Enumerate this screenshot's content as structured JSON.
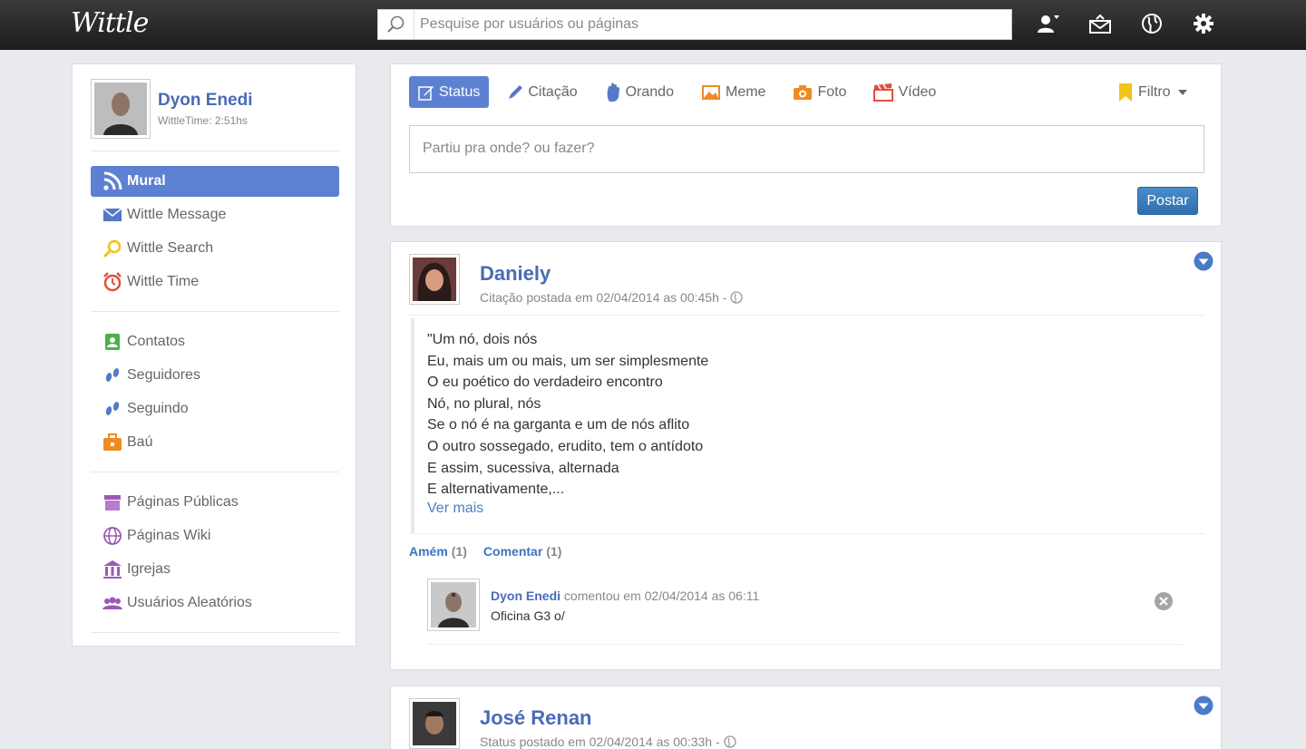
{
  "app": {
    "logo": "Wittle"
  },
  "search": {
    "placeholder": "Pesquise por usuários ou páginas",
    "value": ""
  },
  "top_icons": [
    "friend-request-icon",
    "messages-icon",
    "globe-icon",
    "gear-icon"
  ],
  "profile": {
    "name": "Dyon Enedi",
    "wittletime": "WittleTime: 2:51hs"
  },
  "sidebar": {
    "group1": [
      {
        "label": "Mural",
        "icon": "rss-icon",
        "active": true
      },
      {
        "label": "Wittle Message",
        "icon": "envelope-icon"
      },
      {
        "label": "Wittle Search",
        "icon": "magnifier-icon"
      },
      {
        "label": "Wittle Time",
        "icon": "alarm-clock-icon"
      }
    ],
    "group2": [
      {
        "label": "Contatos",
        "icon": "contacts-icon"
      },
      {
        "label": "Seguidores",
        "icon": "footprints-icon"
      },
      {
        "label": "Seguindo",
        "icon": "footprints-icon"
      },
      {
        "label": "Baú",
        "icon": "chest-icon"
      }
    ],
    "group3": [
      {
        "label": "Páginas Públicas",
        "icon": "store-icon"
      },
      {
        "label": "Páginas Wiki",
        "icon": "globe-icon"
      },
      {
        "label": "Igrejas",
        "icon": "church-icon"
      },
      {
        "label": "Usuários Aleatórios",
        "icon": "users-icon"
      }
    ]
  },
  "composer": {
    "tabs": [
      {
        "label": "Status",
        "icon": "edit-icon",
        "active": true
      },
      {
        "label": "Citação",
        "icon": "pencil-icon"
      },
      {
        "label": "Orando",
        "icon": "praying-hand-icon"
      },
      {
        "label": "Meme",
        "icon": "image-icon"
      },
      {
        "label": "Foto",
        "icon": "camera-icon"
      },
      {
        "label": "Vídeo",
        "icon": "clapperboard-icon"
      }
    ],
    "filter_label": "Filtro",
    "placeholder": "Partiu pra onde? ou fazer?",
    "post_label": "Postar"
  },
  "posts": [
    {
      "author": "Daniely",
      "meta": "Citação postada em 02/04/2014 as 00:45h -",
      "lines": [
        "\"Um nó, dois nós",
        "Eu, mais um ou mais, um ser simplesmente",
        "O eu poético do verdadeiro encontro",
        "Nó, no plural, nós",
        "Se o nó é na garganta e um de nós aflito",
        "O outro sossegado, erudito, tem o antídoto",
        "E assim, sucessiva, alternada",
        "E alternativamente,..."
      ],
      "more": "Ver mais",
      "amen_label": "Amém",
      "amen_count": "(1)",
      "comment_label": "Comentar",
      "comment_count": "(1)",
      "comment": {
        "author": "Dyon Enedi",
        "meta": "comentou em 02/04/2014 as 06:11",
        "text": "Oficina G3 o/"
      }
    },
    {
      "author": "José Renan",
      "meta": "Status postado em 02/04/2014 as 00:33h -"
    }
  ],
  "colors": {
    "accent": "#5d81d2",
    "link": "#4a6bb6",
    "topbar": "#2a2a2a",
    "background": "#e9eaee"
  }
}
